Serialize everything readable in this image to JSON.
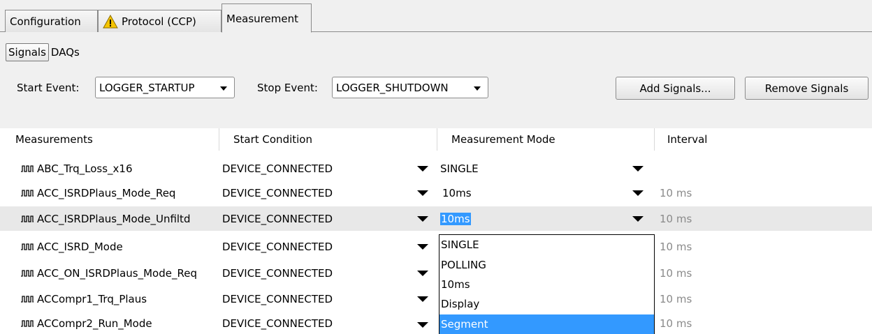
{
  "tabs": {
    "configuration": "Configuration",
    "protocol": "Protocol (CCP)",
    "measurement": "Measurement"
  },
  "subtabs": {
    "signals": "Signals",
    "daqs": "DAQs"
  },
  "events": {
    "start_label": "Start Event:",
    "start_value": "LOGGER_STARTUP",
    "stop_label": "Stop Event:",
    "stop_value": "LOGGER_SHUTDOWN"
  },
  "buttons": {
    "add": "Add Signals...",
    "remove": "Remove Signals"
  },
  "table": {
    "headers": [
      "Measurements",
      "Start Condition",
      "Measurement Mode",
      "Interval"
    ],
    "rows": [
      {
        "name": "ABC_Trq_Loss_x16",
        "start": "DEVICE_CONNECTED",
        "mode": "SINGLE",
        "interval": ""
      },
      {
        "name": "ACC_ISRDPlaus_Mode_Req",
        "start": "DEVICE_CONNECTED",
        "mode": "10ms",
        "interval": "10 ms"
      },
      {
        "name": "ACC_ISRDPlaus_Mode_Unfiltd",
        "start": "DEVICE_CONNECTED",
        "mode": "10ms",
        "interval": "10 ms"
      },
      {
        "name": "ACC_ISRD_Mode",
        "start": "DEVICE_CONNECTED",
        "mode": "",
        "interval": "10 ms"
      },
      {
        "name": "ACC_ON_ISRDPlaus_Mode_Req",
        "start": "DEVICE_CONNECTED",
        "mode": "",
        "interval": "10 ms"
      },
      {
        "name": "ACCompr1_Trq_Plaus",
        "start": "DEVICE_CONNECTED",
        "mode": "",
        "interval": "10 ms"
      },
      {
        "name": "ACCompr2_Run_Mode",
        "start": "DEVICE_CONNECTED",
        "mode": "",
        "interval": "10 ms"
      }
    ]
  },
  "mode_dropdown": {
    "options": [
      "SINGLE",
      "POLLING",
      "10ms",
      "Display",
      "Segment"
    ],
    "highlighted": "Segment"
  },
  "colors": {
    "selection": "#3399ff",
    "selected_row": "#e8e8e8",
    "warning": "#f5c400"
  }
}
